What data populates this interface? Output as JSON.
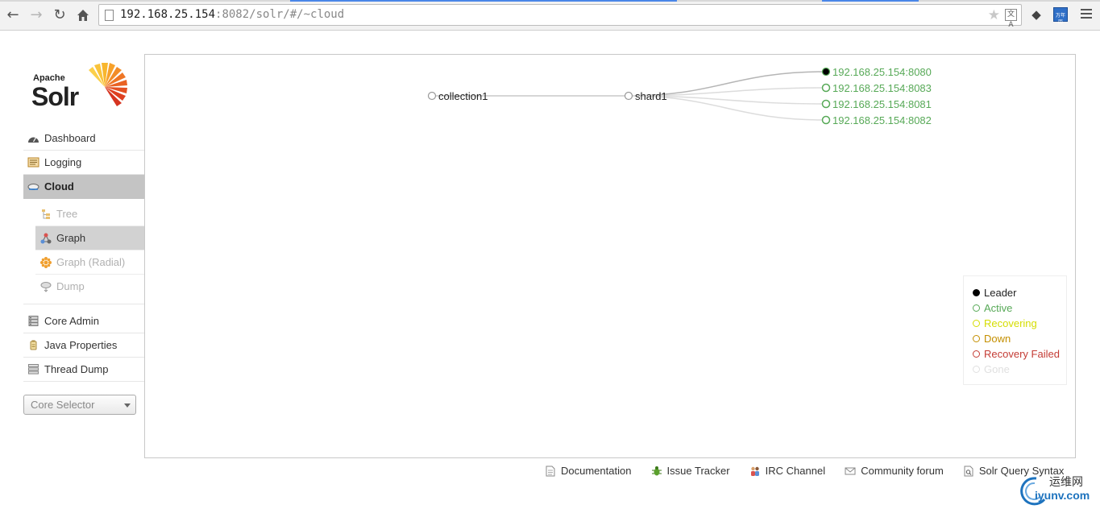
{
  "browser": {
    "url_host": "192.168.25.154",
    "url_rest": ":8082/solr/#/~cloud",
    "translate_label": "文A",
    "ext2_label": "万年历"
  },
  "logo": {
    "apache": "Apache",
    "solr": "Solr"
  },
  "sidebar": {
    "items": [
      {
        "label": "Dashboard"
      },
      {
        "label": "Logging"
      },
      {
        "label": "Cloud"
      },
      {
        "label": "Core Admin"
      },
      {
        "label": "Java Properties"
      },
      {
        "label": "Thread Dump"
      }
    ],
    "cloud_sub": [
      {
        "label": "Tree"
      },
      {
        "label": "Graph"
      },
      {
        "label": "Graph (Radial)"
      },
      {
        "label": "Dump"
      }
    ],
    "core_selector": "Core Selector"
  },
  "graph": {
    "collection": "collection1",
    "shard": "shard1",
    "replicas": [
      {
        "label": "192.168.25.154:8080",
        "state": "leader"
      },
      {
        "label": "192.168.25.154:8083",
        "state": "active"
      },
      {
        "label": "192.168.25.154:8081",
        "state": "active"
      },
      {
        "label": "192.168.25.154:8082",
        "state": "active"
      }
    ]
  },
  "legend": [
    {
      "label": "Leader",
      "color": "#000000",
      "fill": "#000000"
    },
    {
      "label": "Active",
      "color": "#57a957",
      "fill": "none"
    },
    {
      "label": "Recovering",
      "color": "#d5dd00",
      "fill": "none"
    },
    {
      "label": "Down",
      "color": "#c48f00",
      "fill": "none"
    },
    {
      "label": "Recovery Failed",
      "color": "#c43c35",
      "fill": "none"
    },
    {
      "label": "Gone",
      "color": "#e0e0e0",
      "fill": "none"
    }
  ],
  "colors": {
    "active": "#57a957",
    "accent": "#4a86e8"
  },
  "footer": [
    {
      "label": "Documentation"
    },
    {
      "label": "Issue Tracker"
    },
    {
      "label": "IRC Channel"
    },
    {
      "label": "Community forum"
    },
    {
      "label": "Solr Query Syntax"
    }
  ],
  "watermark": {
    "cn": "运维网",
    "en": "iyunv.com"
  }
}
